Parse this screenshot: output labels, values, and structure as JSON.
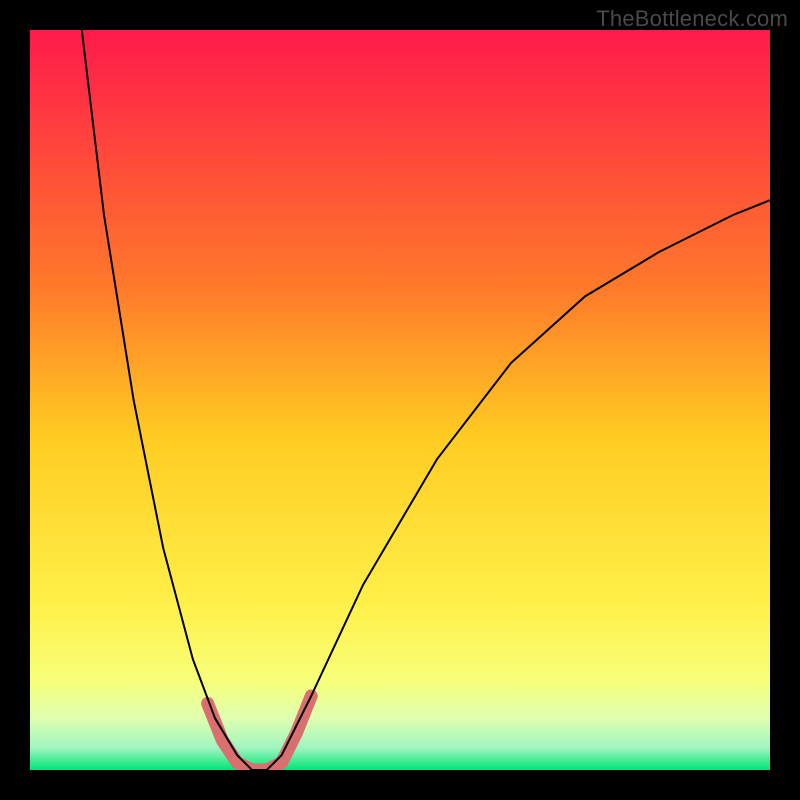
{
  "watermark": {
    "text": "TheBottleneck.com"
  },
  "chart_data": {
    "type": "line",
    "title": "",
    "xlabel": "",
    "ylabel": "",
    "xlim": [
      0,
      100
    ],
    "ylim": [
      0,
      100
    ],
    "grid": false,
    "gradient_stops": [
      {
        "offset": 0,
        "color": "#ff1a4b"
      },
      {
        "offset": 0.35,
        "color": "#ff7a2a"
      },
      {
        "offset": 0.55,
        "color": "#ffcc22"
      },
      {
        "offset": 0.78,
        "color": "#fff04a"
      },
      {
        "offset": 0.88,
        "color": "#f7ff7a"
      },
      {
        "offset": 0.93,
        "color": "#dfffb0"
      },
      {
        "offset": 0.97,
        "color": "#a0f5c0"
      },
      {
        "offset": 1.0,
        "color": "#00e676"
      }
    ],
    "series": [
      {
        "name": "bottleneck-curve",
        "color": "#000000",
        "width": 2,
        "points": [
          {
            "x": 7,
            "y": 100
          },
          {
            "x": 10,
            "y": 75
          },
          {
            "x": 14,
            "y": 50
          },
          {
            "x": 18,
            "y": 30
          },
          {
            "x": 22,
            "y": 15
          },
          {
            "x": 25,
            "y": 7
          },
          {
            "x": 28,
            "y": 2
          },
          {
            "x": 30,
            "y": 0
          },
          {
            "x": 32,
            "y": 0
          },
          {
            "x": 34,
            "y": 2
          },
          {
            "x": 38,
            "y": 10
          },
          {
            "x": 45,
            "y": 25
          },
          {
            "x": 55,
            "y": 42
          },
          {
            "x": 65,
            "y": 55
          },
          {
            "x": 75,
            "y": 64
          },
          {
            "x": 85,
            "y": 70
          },
          {
            "x": 95,
            "y": 75
          },
          {
            "x": 100,
            "y": 77
          }
        ]
      },
      {
        "name": "highlight-band",
        "color": "#d9706f",
        "width": 13,
        "linecap": "round",
        "points": [
          {
            "x": 24,
            "y": 9
          },
          {
            "x": 26,
            "y": 4
          },
          {
            "x": 28,
            "y": 1
          },
          {
            "x": 30,
            "y": 0
          },
          {
            "x": 32,
            "y": 0
          },
          {
            "x": 34,
            "y": 1
          },
          {
            "x": 36,
            "y": 5
          },
          {
            "x": 38,
            "y": 10
          }
        ]
      }
    ]
  }
}
